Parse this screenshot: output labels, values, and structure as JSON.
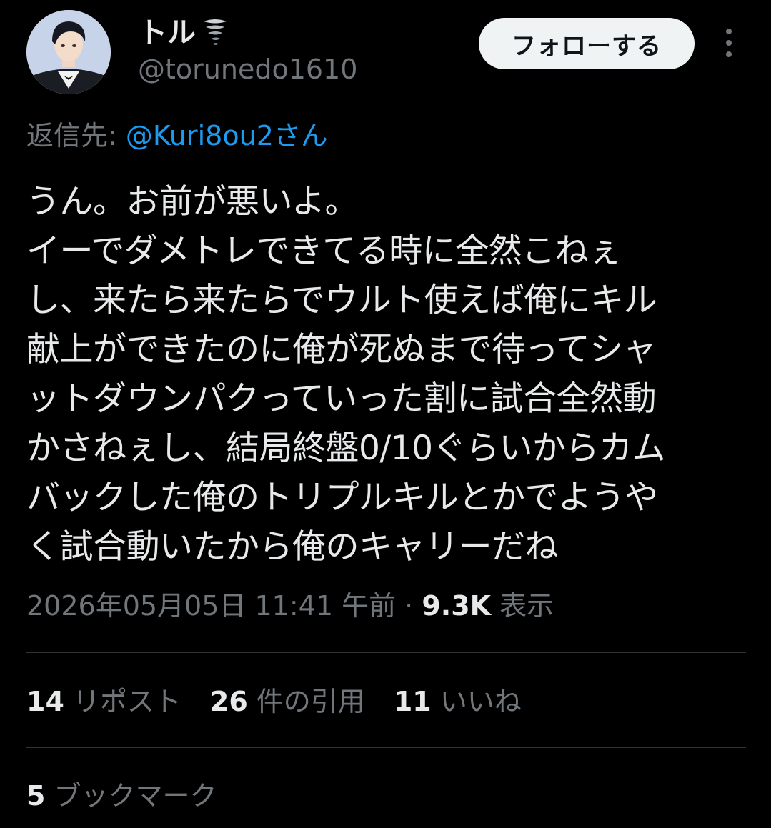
{
  "author": {
    "display_name": "トル",
    "handle": "@torunedo1610",
    "name_emoji_icon": "tornado-icon"
  },
  "follow_button": {
    "label": "フォローする"
  },
  "more_menu": {
    "icon": "more-vertical-icon"
  },
  "reply": {
    "prefix": "返信先: ",
    "mention": "@Kuri8ou2さん"
  },
  "tweet": {
    "lines": [
      "うん。お前が悪いよ。",
      "イーでダメトレできてる時に全然こねぇ",
      "し、来たら来たらでウルト使えば俺にキル",
      "献上ができたのに俺が死ぬまで待ってシャ",
      "ットダウンパクっていった割に試合全然動",
      "かさねぇし、結局終盤0/10ぐらいからカム",
      "バックした俺のトリプルキルとかでようや",
      "く試合動いたから俺のキャリーだね"
    ]
  },
  "meta": {
    "timestamp": "2026年05月05日 11:41 午前 · ",
    "views_count": "9.3K",
    "views_label": " 表示"
  },
  "stats": [
    {
      "count": "14",
      "label": "リポスト"
    },
    {
      "count": "26",
      "label": "件の引用"
    },
    {
      "count": "11",
      "label": "いいね"
    }
  ],
  "bookmarks": {
    "count": "5",
    "label": "ブックマーク"
  },
  "colors": {
    "background": "#000000",
    "text_primary": "#e7e9ea",
    "text_secondary": "#71767b",
    "link": "#1d9bf0",
    "button_bg": "#eff3f4",
    "divider": "#2f3336"
  }
}
